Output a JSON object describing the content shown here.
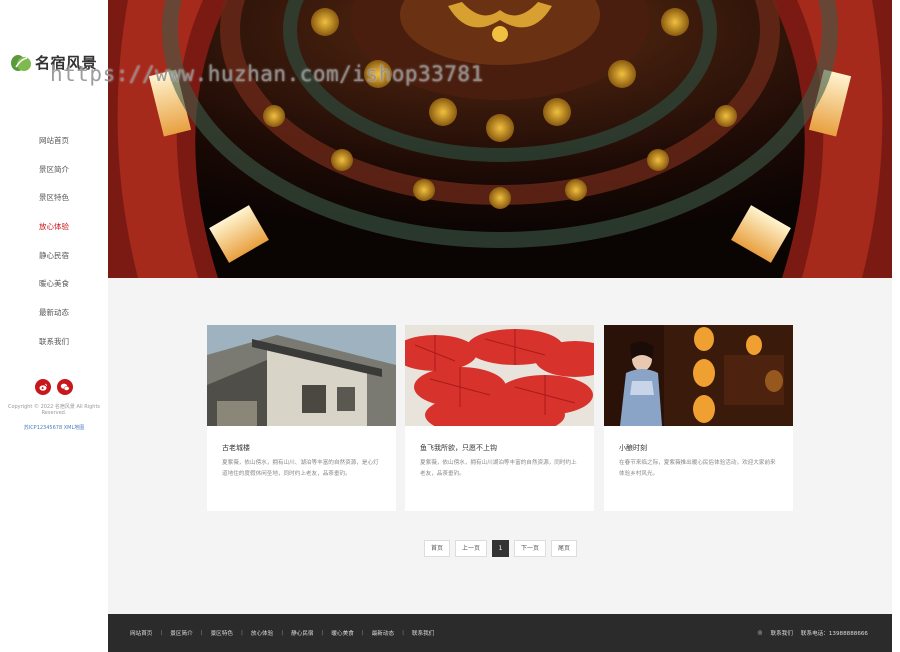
{
  "brand": {
    "name": "名宿风景"
  },
  "watermark": "https://www.huzhan.com/ishop33781",
  "nav": [
    {
      "label": "网站首页",
      "active": false
    },
    {
      "label": "景区简介",
      "active": false
    },
    {
      "label": "景区特色",
      "active": false
    },
    {
      "label": "放心体验",
      "active": true
    },
    {
      "label": "静心民宿",
      "active": false
    },
    {
      "label": "暖心美食",
      "active": false
    },
    {
      "label": "最新动态",
      "active": false
    },
    {
      "label": "联系我们",
      "active": false
    }
  ],
  "sidebar_footer": {
    "social_icons": [
      "weibo-icon",
      "wechat-icon"
    ],
    "copyright": "Copyright © 2022 名宿风景 All Rights Reserved.",
    "icp": "苏ICP12345678",
    "sitemap": "XML地图"
  },
  "cards": [
    {
      "title": "古老城楼",
      "text": "夏紫薇，依山傍水，拥有山川、湖泊等丰富的自然资源，是心灯道地住的度假休闲圣地，同时约上老友，品茶垂钓。"
    },
    {
      "title": "鱼飞我所欲，只愿不上钩",
      "text": "夏紫薇，依山傍水，拥有山川湖泊等丰富的自然资源，同时约上老友，品茶垂钓。"
    },
    {
      "title": "小酿时刻",
      "text": "在春节来临之际，夏紫薇推出暖心民俗体验活动，欢迎大家前来体验乡村风光。"
    }
  ],
  "pagination": {
    "first": "首页",
    "prev": "上一页",
    "current": "1",
    "next": "下一页",
    "last": "尾页"
  },
  "footer": {
    "links": [
      "网站首页",
      "景区简介",
      "景区特色",
      "放心体验",
      "静心民宿",
      "暖心美食",
      "最新动态",
      "联系我们"
    ],
    "contact_label": "联系我们",
    "phone": "联系电话：13988888666"
  },
  "colors": {
    "accent": "#c8161d",
    "footer_bg": "#2b2b2b",
    "page_bg": "#f4f4f4"
  }
}
